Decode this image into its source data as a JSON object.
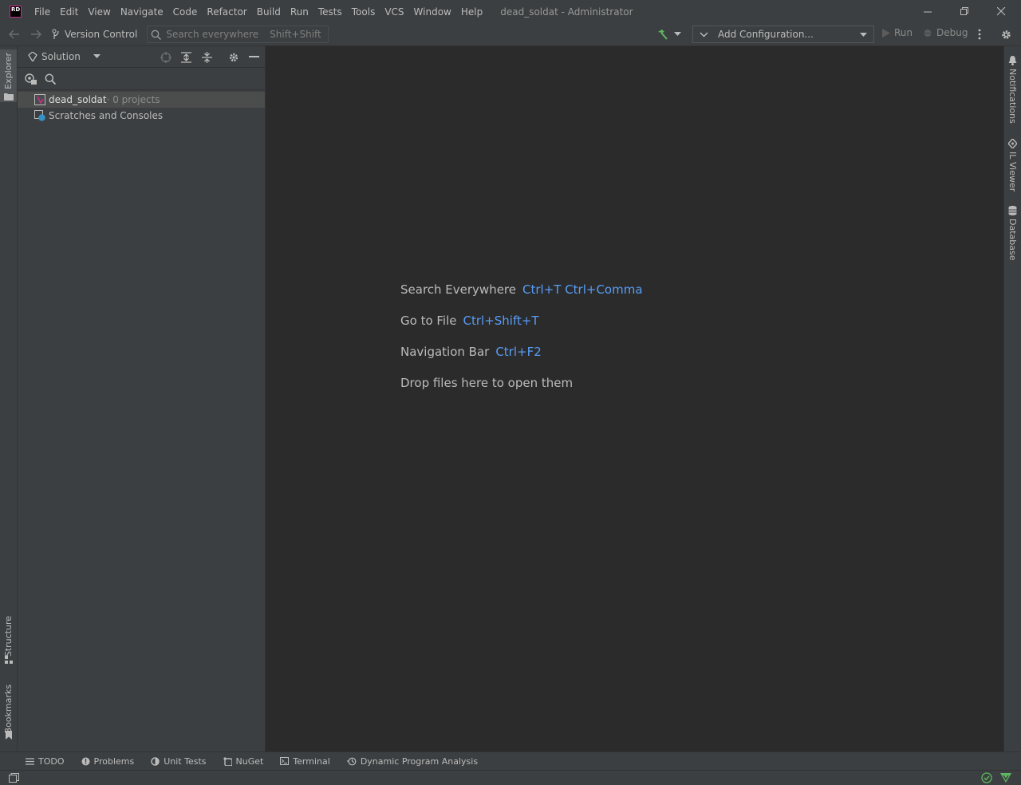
{
  "app": {
    "logo_text": "RD",
    "window_title": "dead_soldat - Administrator"
  },
  "menu": {
    "items": [
      "File",
      "Edit",
      "View",
      "Navigate",
      "Code",
      "Refactor",
      "Build",
      "Run",
      "Tests",
      "Tools",
      "VCS",
      "Window",
      "Help"
    ]
  },
  "window_controls": {
    "minimize": "─",
    "restore": "❐",
    "close": "✕"
  },
  "toolbar": {
    "vcs_label": "Version Control",
    "search_placeholder": "Search everywhere",
    "search_shortcut": "Shift+Shift",
    "config_label": "Add Configuration...",
    "run_label": "Run",
    "debug_label": "Debug"
  },
  "left_stripe": {
    "top_label": "Explorer",
    "bottom_labels": [
      "Structure",
      "Bookmarks"
    ]
  },
  "right_stripe": {
    "labels": [
      "Notifications",
      "IL Viewer",
      "Database"
    ]
  },
  "explorer": {
    "view_label": "Solution",
    "tree": [
      {
        "name": "dead_soldat",
        "suffix": " · 0 projects",
        "selected": true
      },
      {
        "name": "Scratches and Consoles",
        "suffix": "",
        "selected": false
      }
    ]
  },
  "editor_hints": [
    {
      "label": "Search Everywhere",
      "shortcut": "Ctrl+T Ctrl+Comma"
    },
    {
      "label": "Go to File",
      "shortcut": "Ctrl+Shift+T"
    },
    {
      "label": "Navigation Bar",
      "shortcut": "Ctrl+F2"
    },
    {
      "label": "Drop files here to open them",
      "shortcut": ""
    }
  ],
  "bottom_tabs": [
    "TODO",
    "Problems",
    "Unit Tests",
    "NuGet",
    "Terminal",
    "Dynamic Program Analysis"
  ],
  "colors": {
    "accent_link": "#589df6",
    "panel_bg": "#3c3f41",
    "editor_bg": "#2b2b2b",
    "status_ok": "#5fb85f"
  }
}
